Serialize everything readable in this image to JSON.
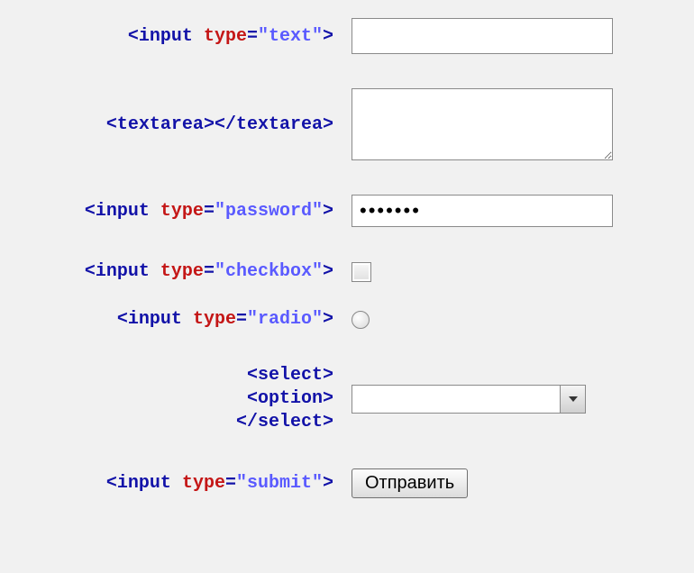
{
  "rows": {
    "text_input": {
      "label_parts": {
        "open": "<",
        "tag": "input",
        "sp": " ",
        "attr": "type",
        "eq": "=",
        "val": "\"text\"",
        "close": ">"
      },
      "value": ""
    },
    "textarea": {
      "label_parts": {
        "open": "<",
        "tag": "textarea",
        "close_open": ">",
        "open2": "</",
        "close2": ">"
      },
      "value": ""
    },
    "password": {
      "label_parts": {
        "open": "<",
        "tag": "input",
        "sp": " ",
        "attr": "type",
        "eq": "=",
        "val": "\"password\"",
        "close": ">"
      },
      "value": "•••••••"
    },
    "checkbox": {
      "label_parts": {
        "open": "<",
        "tag": "input",
        "sp": " ",
        "attr": "type",
        "eq": "=",
        "val": "\"checkbox\"",
        "close": ">"
      }
    },
    "radio": {
      "label_parts": {
        "open": "<",
        "tag": "input",
        "sp": " ",
        "attr": "type",
        "eq": "=",
        "val": "\"radio\"",
        "close": ">"
      }
    },
    "select": {
      "line1": {
        "open": "<",
        "tag": "select",
        "close": ">"
      },
      "line2": {
        "open": "<",
        "tag": "option",
        "close": ">"
      },
      "line3": {
        "open": "</",
        "tag": "select",
        "close": ">"
      },
      "value": ""
    },
    "submit": {
      "label_parts": {
        "open": "<",
        "tag": "input",
        "sp": " ",
        "attr": "type",
        "eq": "=",
        "val": "\"submit\"",
        "close": ">"
      },
      "button_label": "Отправить"
    }
  }
}
